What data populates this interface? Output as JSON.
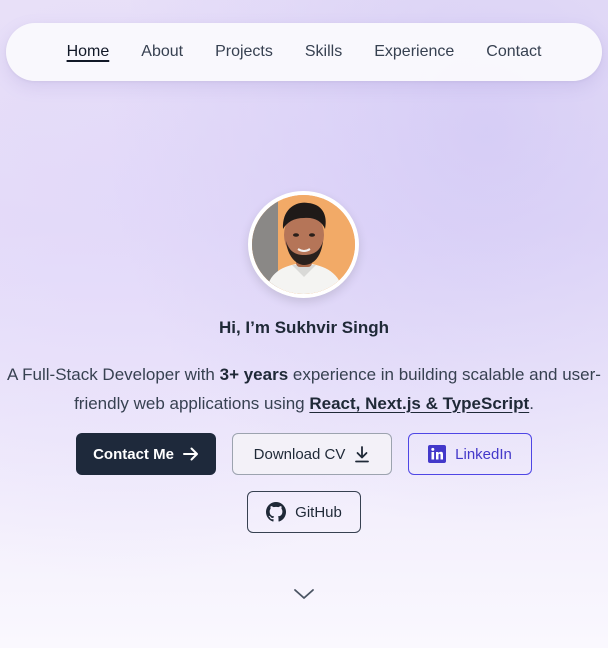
{
  "nav": {
    "items": [
      {
        "label": "Home",
        "active": true
      },
      {
        "label": "About"
      },
      {
        "label": "Projects"
      },
      {
        "label": "Skills"
      },
      {
        "label": "Experience"
      },
      {
        "label": "Contact"
      }
    ]
  },
  "hero": {
    "greeting": "Hi, I’m Sukhvir Singh",
    "intro_part1": "A Full-Stack Developer with ",
    "intro_years": "3+ years",
    "intro_part2": " experience in building scalable and user-friendly web applications using ",
    "intro_tech": "React, Next.js & TypeScript",
    "intro_end": "."
  },
  "buttons": {
    "contact": "Contact Me",
    "cv": "Download CV",
    "linkedin": "LinkedIn",
    "github": "GitHub"
  },
  "colors": {
    "primary_button": "#1e293b",
    "linkedin_accent": "#4f46e5"
  },
  "icons": {
    "contact": "arrow-right-icon",
    "cv": "download-icon",
    "linkedin": "linkedin-icon",
    "github": "github-icon",
    "scroll": "chevron-down-icon"
  }
}
